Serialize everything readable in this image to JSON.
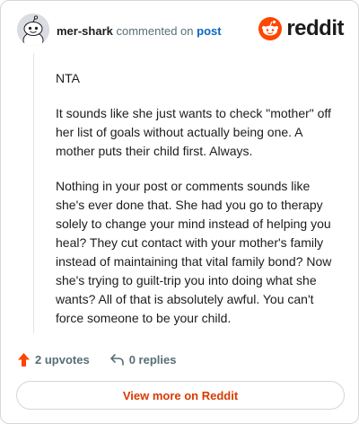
{
  "header": {
    "username": "mer-shark",
    "verb": "commented on",
    "post_link": "post",
    "brand": "reddit"
  },
  "comment": {
    "paragraphs": [
      "NTA",
      "It sounds like she just wants to check \"mother\" off her list of goals without actually being one. A mother puts their child first. Always.",
      "Nothing in your post or comments sounds like she's ever done that. She had you go to therapy solely to change your mind instead of helping you heal? They cut contact with your mother's family instead of maintaining that vital family bond? Now she's trying to guilt-trip you into doing what she wants? All of that is absolutely awful. You can't force someone to be your child."
    ]
  },
  "actions": {
    "upvotes": "2 upvotes",
    "replies": "0 replies"
  },
  "footer": {
    "view_more": "View more on Reddit"
  },
  "colors": {
    "accent": "#d93a00",
    "upvote": "#ff4500",
    "link": "#0a66c2",
    "muted": "#576f76"
  },
  "icons": {
    "avatar": "snoo-avatar-icon",
    "brand": "reddit-logo-icon",
    "upvote": "upvote-arrow-icon",
    "reply": "reply-arrow-icon"
  }
}
